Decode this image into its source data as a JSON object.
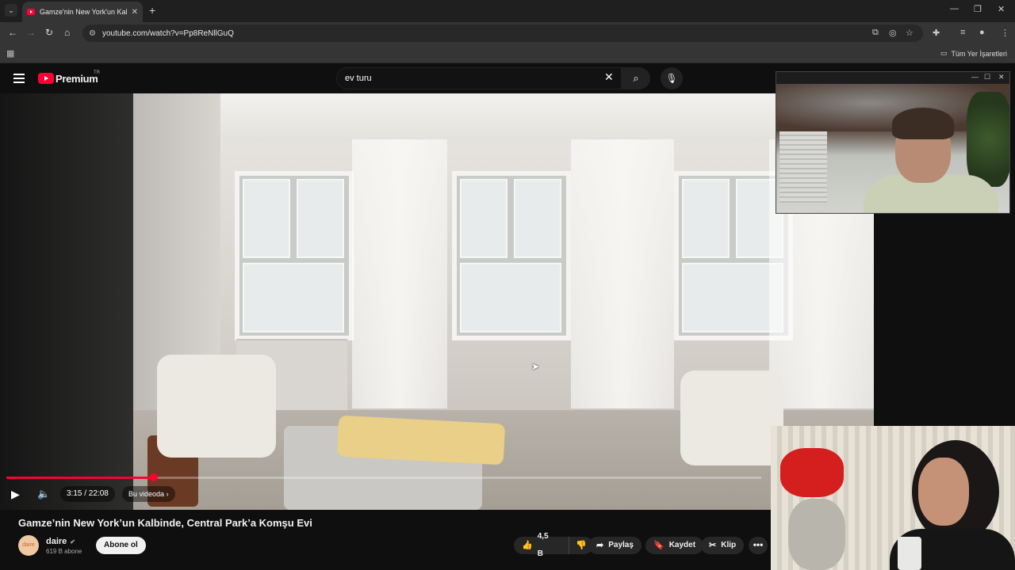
{
  "browser": {
    "tab_title": "Gamze'nin New York'un Kalbinde, Central Park'a Komşu Evi",
    "tab_close": "✕",
    "new_tab": "+",
    "url": "youtube.com/watch?v=Pp8ReNllGuQ",
    "all_bookmarks": "Tüm Yer İşaretleri"
  },
  "header": {
    "brand": "Premium",
    "region": "TR",
    "search_value": "ev turu"
  },
  "player": {
    "time": "3:15 / 22:08",
    "chapter_label": "Bu videoda",
    "progress": 0.195
  },
  "video": {
    "title": "Gamze’nin New York’un Kalbinde, Central Park’a Komşu Evi",
    "channel": "daire",
    "avatar_text": "daire",
    "subscribers": "619 B abone",
    "subscribe": "Abone ol",
    "likes": "4,5 B",
    "share": "Paylaş",
    "save": "Kaydet",
    "clip": "Klip",
    "more": "•••"
  },
  "colors": {
    "accent": "#ff0033",
    "page_bg": "#0f0f0f"
  }
}
